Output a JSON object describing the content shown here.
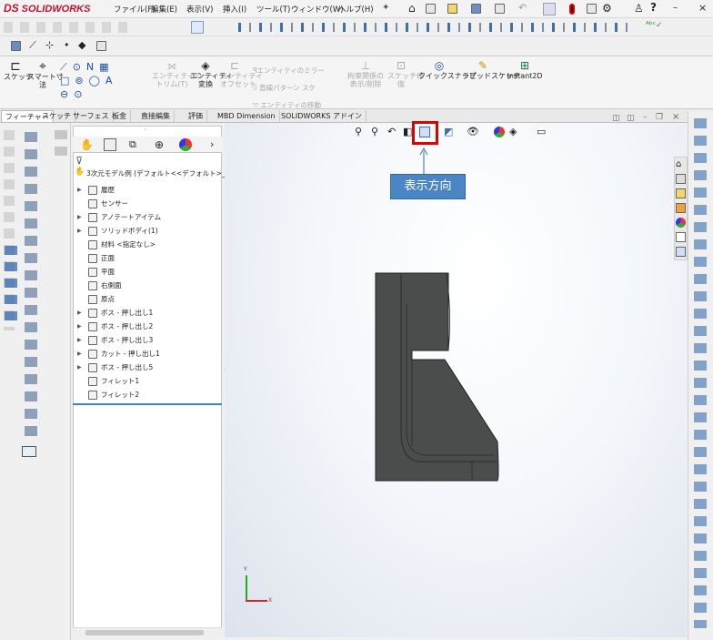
{
  "app": {
    "brand": "SOLIDWORKS",
    "logo_text": "DS"
  },
  "menu": [
    "ファイル(F)",
    "編集(E)",
    "表示(V)",
    "挿入(I)",
    "ツール(T)",
    "ウィンドウ(W)",
    "ヘルプ(H)"
  ],
  "ribbon": {
    "sketch": "スケッチ",
    "smart_dim_1": "スマート寸",
    "smart_dim_2": "法",
    "trim_1": "エンティティの",
    "trim_2": "トリム(T)",
    "convert_1": "エンティティ",
    "convert_2": "変換",
    "offset_1": "エンティティ",
    "offset_2": "オフセット",
    "mirror": "エンティティのミラー",
    "linear_pattern": "直線パターン スケ",
    "move": "エンティティの移動",
    "relations_1": "拘束関係の",
    "relations_2": "表示/削除",
    "repair_1": "スケッチ修",
    "repair_2": "復",
    "quick_snap": "クイックスナップ",
    "rapid_sketch": "ラピッドスケッチ",
    "instant2d": "Instant2D"
  },
  "tabs": [
    "フィーチャー",
    "スケッチ",
    "サーフェス",
    "板金",
    "直接編集",
    "評価",
    "MBD Dimension",
    "SOLIDWORKS アドイン"
  ],
  "tree": {
    "root": "3次元モデル例 (デフォルト<<デフォルト>_表示状",
    "items": [
      {
        "label": "履歴",
        "arrow": true
      },
      {
        "label": "センサー",
        "arrow": false
      },
      {
        "label": "アノテートアイテム",
        "arrow": true
      },
      {
        "label": "ソリッドボディ(1)",
        "arrow": true
      },
      {
        "label": "材料 <指定なし>",
        "arrow": false
      },
      {
        "label": "正面",
        "arrow": false
      },
      {
        "label": "平面",
        "arrow": false
      },
      {
        "label": "右側面",
        "arrow": false
      },
      {
        "label": "原点",
        "arrow": false
      },
      {
        "label": "ボス - 押し出し1",
        "arrow": true
      },
      {
        "label": "ボス - 押し出し2",
        "arrow": true
      },
      {
        "label": "ボス - 押し出し3",
        "arrow": true
      },
      {
        "label": "カット - 押し出し1",
        "arrow": true
      },
      {
        "label": "ボス - 押し出し5",
        "arrow": true
      },
      {
        "label": "フィレット1",
        "arrow": false
      },
      {
        "label": "フィレット2",
        "arrow": false
      }
    ]
  },
  "tooltip": "表示方向",
  "colors": {
    "highlight": "#e00000",
    "tooltip_bg": "#4a86c6",
    "model": "#4b4d4d",
    "brand": "#c8102e"
  },
  "triad": {
    "x": "X",
    "y": "Y"
  }
}
